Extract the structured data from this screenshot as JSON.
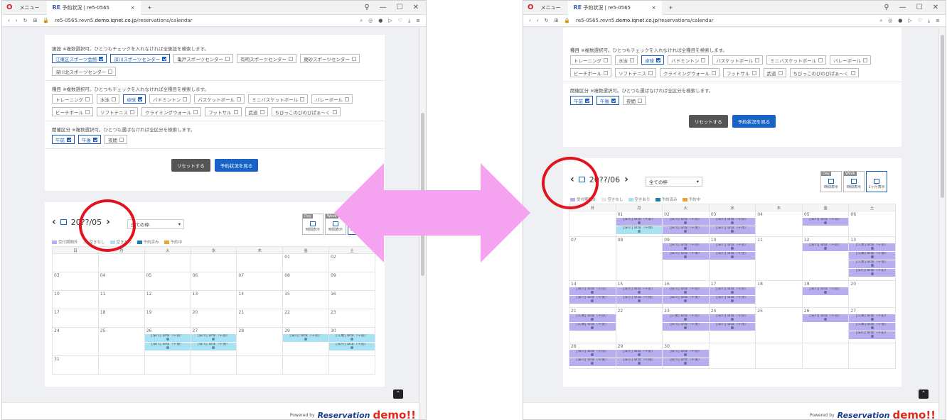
{
  "browser": {
    "menu_label": "メニュー",
    "tab_title": "予約状況 | re5-0565",
    "tab_close": "×",
    "tab_new": "+",
    "url_prefix": "re5-0565.revn5.",
    "url_domain": "demo.iqnet.co.jp",
    "url_path": "/reservations/calendar"
  },
  "filters": {
    "facility_label": "施設",
    "facility_note": "※複数選択可。ひとつもチェックを入れなければ全施設を検索します。",
    "facilities": [
      {
        "label": "江東区スポーツ会館",
        "checked": true
      },
      {
        "label": "深川スポーツセンター",
        "checked": true
      },
      {
        "label": "亀戸スポーツセンター",
        "checked": false
      },
      {
        "label": "有明スポーツセンター",
        "checked": false
      },
      {
        "label": "東砂スポーツセンター",
        "checked": false
      },
      {
        "label": "深川北スポーツセンター",
        "checked": false
      }
    ],
    "sport_label": "種目",
    "sport_note": "※複数選択可。ひとつもチェックを入れなければ全種目を検索します。",
    "sports": [
      {
        "label": "トレーニング",
        "checked": false
      },
      {
        "label": "水泳",
        "checked": false
      },
      {
        "label": "卓球",
        "checked": true
      },
      {
        "label": "バドミントン",
        "checked": false
      },
      {
        "label": "バスケットボール",
        "checked": false
      },
      {
        "label": "ミニバスケットボール",
        "checked": false
      },
      {
        "label": "バレーボール",
        "checked": false
      },
      {
        "label": "ビーチボール",
        "checked": false
      },
      {
        "label": "ソフトテニス",
        "checked": false
      },
      {
        "label": "クライミングウォール",
        "checked": false
      },
      {
        "label": "フットサル",
        "checked": false
      },
      {
        "label": "武道",
        "checked": false
      },
      {
        "label": "ちびっこのびのびぱぁ〜く",
        "checked": false
      }
    ],
    "period_label": "開催区分",
    "period_note": "※複数選択可。ひとつも選ばなければ全区分を検索します。",
    "periods": [
      {
        "label": "午前",
        "checked": true
      },
      {
        "label": "午後",
        "checked": true
      },
      {
        "label": "夜間",
        "checked": false
      }
    ],
    "reset_label": "リセットする",
    "view_label": "予約状況を見る"
  },
  "calendar_left": {
    "month_label": "20??/05",
    "frame_select": "全ての枠",
    "weekdays": [
      "日",
      "月",
      "火",
      "水",
      "木",
      "金",
      "土"
    ],
    "weeks": [
      [
        "",
        "",
        "",
        "",
        "",
        "01",
        "02"
      ],
      [
        "03",
        "04",
        "05",
        "06",
        "07",
        "08",
        "09"
      ],
      [
        "10",
        "11",
        "12",
        "13",
        "14",
        "15",
        "16"
      ],
      [
        "17",
        "18",
        "19",
        "20",
        "21",
        "22",
        "23"
      ],
      [
        "24",
        "25",
        "26",
        "27",
        "28",
        "29",
        "30"
      ],
      [
        "31",
        "",
        "",
        "",
        "",
        "",
        ""
      ]
    ]
  },
  "calendar_right": {
    "month_label": "20??/06",
    "frame_select": "全ての枠",
    "weekdays": [
      "日",
      "月",
      "火",
      "水",
      "木",
      "金",
      "土"
    ],
    "weeks": [
      [
        "",
        "01",
        "02",
        "03",
        "04",
        "05",
        "06"
      ],
      [
        "07",
        "08",
        "09",
        "10",
        "11",
        "12",
        "13"
      ],
      [
        "14",
        "15",
        "16",
        "17",
        "18",
        "19",
        "20"
      ],
      [
        "21",
        "22",
        "23",
        "24",
        "25",
        "26",
        "27"
      ],
      [
        "28",
        "29",
        "30",
        "",
        "",
        "",
        ""
      ]
    ]
  },
  "legend": [
    {
      "label": "受付期間外",
      "color": "#b7aef0"
    },
    {
      "label": "空きなし",
      "color": "#e8e8e8"
    },
    {
      "label": "空きあり",
      "color": "#a9e2f3"
    },
    {
      "label": "予約済み",
      "color": "#1d7fa8"
    },
    {
      "label": "予約中",
      "color": "#f0a030"
    }
  ],
  "view_buttons": [
    {
      "tag": "Day",
      "label": "時間表示"
    },
    {
      "tag": "Week",
      "label": "時間表示"
    },
    {
      "tag": "",
      "label": "1ヶ月表示"
    }
  ],
  "event_text": {
    "fukagawa_am": "[深川] 卓球（午前）",
    "fukagawa_pm": "[深川] 卓球（午後）",
    "koto_am": "[江東] 卓球（午前）",
    "koto_pm": "[江東] 卓球（午後）"
  },
  "footer": {
    "powered_by": "Powered by",
    "logo_text": "Reservation",
    "demo_text": "demo!!"
  },
  "colors": {
    "accent": "#1763c6",
    "highlight_circle": "#e3121f",
    "arrow": "#f5a3f0"
  }
}
